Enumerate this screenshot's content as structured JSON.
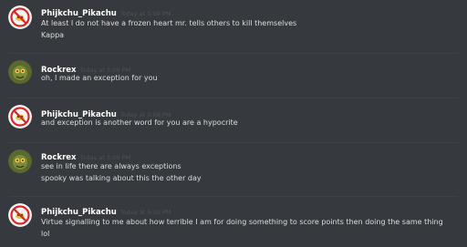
{
  "colors": {
    "background": "#36393e",
    "username": "#ffffff",
    "message_text": "#dcddde",
    "timestamp": "#4f5358",
    "divider": "#3e4146"
  },
  "messages": [
    {
      "author": "Phijkchu_Pikachu",
      "avatar": "pikachu-no-sign-avatar",
      "timestamp": "Today at 5:09 PM",
      "lines": [
        "At least I do not have a frozen heart mr. tells others to kill themselves",
        "Kappa"
      ]
    },
    {
      "author": "Rockrex",
      "avatar": "rockrex-avatar",
      "timestamp": "Today at 5:09 PM",
      "lines": [
        "oh, I made an exception for you"
      ]
    },
    {
      "author": "Phijkchu_Pikachu",
      "avatar": "pikachu-no-sign-avatar",
      "timestamp": "Today at 5:09 PM",
      "lines": [
        "and exception is another word for you are a hypocrite"
      ]
    },
    {
      "author": "Rockrex",
      "avatar": "rockrex-avatar",
      "timestamp": "Today at 5:09 PM",
      "lines": [
        "see in life there are always exceptions",
        "spooky was talking about this the other day"
      ]
    },
    {
      "author": "Phijkchu_Pikachu",
      "avatar": "pikachu-no-sign-avatar",
      "timestamp": "Today at 5:10 PM",
      "lines": [
        "Virtue signalling to me about how terrible I am for doing something to score points then doing the same thing",
        "lol"
      ]
    }
  ]
}
